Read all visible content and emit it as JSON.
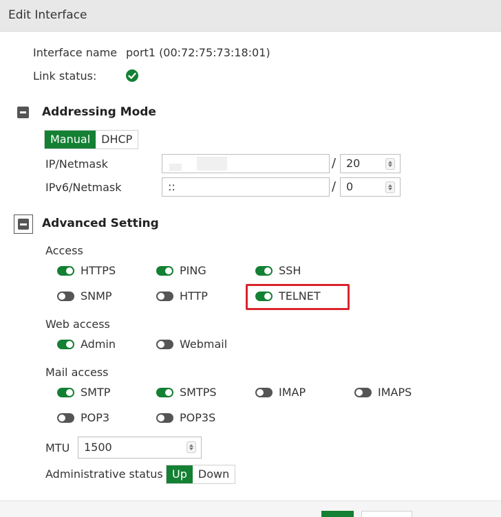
{
  "dialog": {
    "title": "Edit Interface"
  },
  "info": {
    "interface_name_label": "Interface name",
    "interface_name_value": "port1 (00:72:75:73:18:01)",
    "link_status_label": "Link status:"
  },
  "addressing": {
    "heading": "Addressing Mode",
    "modes": [
      "Manual",
      "DHCP"
    ],
    "selected": "Manual",
    "ip_label": "IP/Netmask",
    "ip_value": "",
    "ip_prefix": "20",
    "ipv6_label": "IPv6/Netmask",
    "ipv6_value": "::",
    "ipv6_prefix": "0",
    "slash": "/"
  },
  "advanced": {
    "heading": "Advanced Setting",
    "access_label": "Access",
    "access": [
      {
        "label": "HTTPS",
        "on": true
      },
      {
        "label": "PING",
        "on": true
      },
      {
        "label": "SSH",
        "on": true
      },
      {
        "label": "SNMP",
        "on": false
      },
      {
        "label": "HTTP",
        "on": false
      },
      {
        "label": "TELNET",
        "on": true
      }
    ],
    "web_access_label": "Web access",
    "web_access": [
      {
        "label": "Admin",
        "on": true
      },
      {
        "label": "Webmail",
        "on": false
      }
    ],
    "mail_access_label": "Mail access",
    "mail_access": [
      {
        "label": "SMTP",
        "on": true
      },
      {
        "label": "SMTPS",
        "on": true
      },
      {
        "label": "IMAP",
        "on": false
      },
      {
        "label": "IMAPS",
        "on": false
      },
      {
        "label": "POP3",
        "on": false
      },
      {
        "label": "POP3S",
        "on": false
      }
    ],
    "mtu_label": "MTU",
    "mtu_value": "1500",
    "admin_status_label": "Administrative status",
    "admin_status_options": [
      "Up",
      "Down"
    ],
    "admin_status_selected": "Up"
  },
  "colors": {
    "accent": "#148033",
    "highlight": "#d9232e",
    "toggle_off": "#555555"
  }
}
